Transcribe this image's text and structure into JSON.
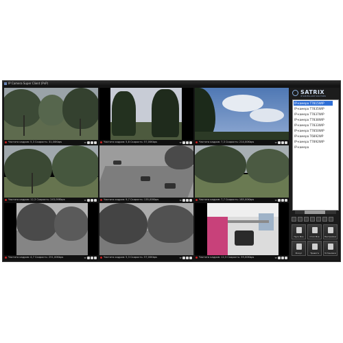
{
  "window": {
    "title": "IP Camera Super Client (PnP)"
  },
  "cameras": [
    {
      "status": "Частота кадров: 5,3    Скорость: 31,00Kbps"
    },
    {
      "status": "Частота кадров: 5,8    Скорость: 57,00Kbps"
    },
    {
      "status": "Частота кадров: 7,3    Скорость: 214,00Kbps"
    },
    {
      "status": "Частота кадров: 12,3    Скорость: 243,00Kbps"
    },
    {
      "status": "Частота кадров: 9,7    Скорость: 135,00Kbps"
    },
    {
      "status": "Частота кадров: 7,7    Скорость: 185,00Kbps"
    },
    {
      "status": "Частота кадров: 4,7    Скорость: 251,00Kbps"
    },
    {
      "status": "Частота кадров: 5,3    Скорость: 57,00Kbps"
    },
    {
      "status": "Частота кадров: 12,3    Скорость: 59,00Kbps"
    }
  ],
  "brand": {
    "name": "SATRIX",
    "tagline": "IP SURVEILLANCE SOLUTIONS"
  },
  "camera_list": [
    "IP-камера T7815WIP",
    "IP-камера T7835WIP",
    "IP-камера T7837WIP",
    "IP-камера T7838WIP",
    "IP-камера T7833WIP",
    "IP-камера T7850WIP",
    "IP-камера T6892WP",
    "IP-камера T7892WIP",
    "IP-камера"
  ],
  "actions": [
    {
      "label": "Пуск Все",
      "icon": "play-all-icon"
    },
    {
      "label": "Стоп Все",
      "icon": "stop-all-icon"
    },
    {
      "label": "Настройки",
      "icon": "settings-icon"
    },
    {
      "label": "Фокус",
      "icon": "focus-icon"
    },
    {
      "label": "Тревога",
      "icon": "alarm-icon"
    },
    {
      "label": "Установки",
      "icon": "tools-icon"
    }
  ],
  "colors": {
    "selection": "#2f6fd6",
    "record": "#cc2222",
    "panel": "#1c1c1c"
  }
}
